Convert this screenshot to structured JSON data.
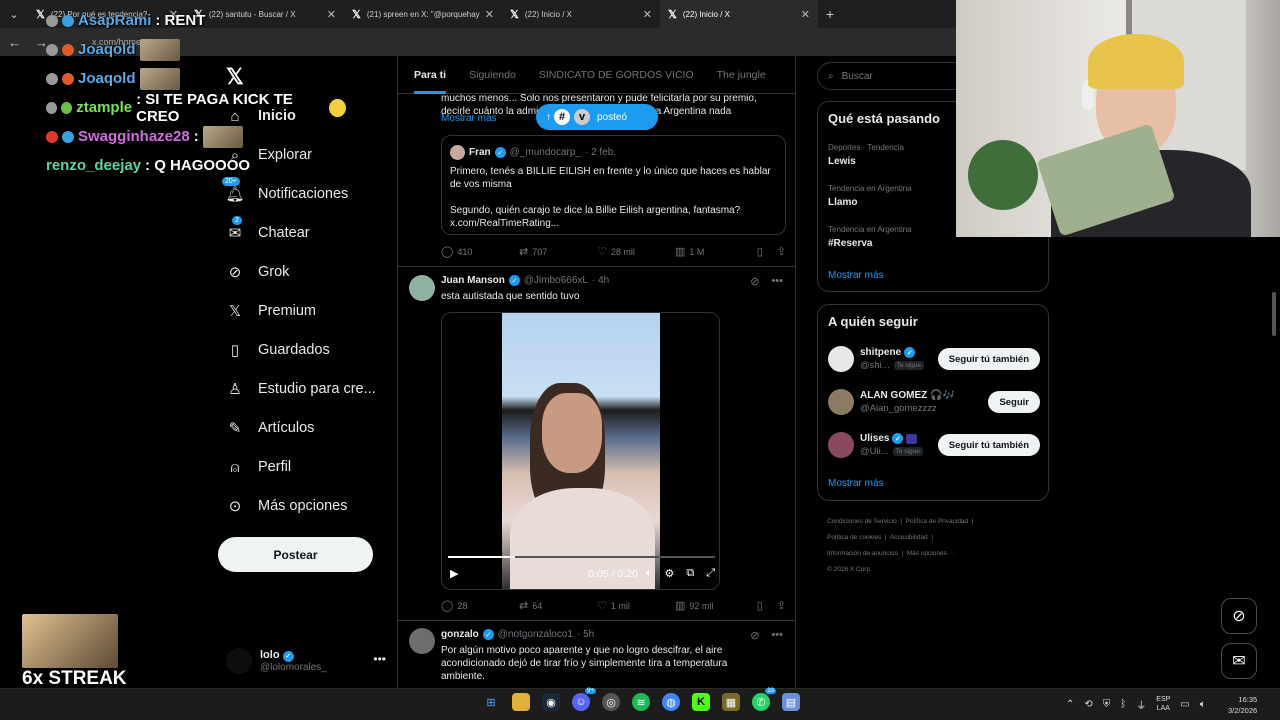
{
  "browser": {
    "tabs": [
      {
        "title": "(22) Por qué es tendencia?",
        "active": false
      },
      {
        "title": "(22) santutu - Buscar / X",
        "active": false
      },
      {
        "title": "(21) spreen en X: \"@porquehay",
        "active": false
      },
      {
        "title": "(22) Inicio / X",
        "active": false
      },
      {
        "title": "(22) Inicio / X",
        "active": true
      }
    ],
    "url": "x.com/home",
    "new_tab": "+"
  },
  "stream_chat": [
    {
      "user": "AsapRami",
      "message": ": RENT"
    },
    {
      "user": "Joaqold",
      "message": ""
    },
    {
      "user": "Joaqold",
      "message": ""
    },
    {
      "user": "ztample",
      "message": ": SI TE PAGA KICK TE CREO"
    },
    {
      "user": "Swagginhaze28",
      "message": ":"
    },
    {
      "user": "renzo_deejay",
      "message": ": Q HAGOOOO"
    }
  ],
  "nav": {
    "items": [
      {
        "label": "Inicio",
        "icon": "home-icon"
      },
      {
        "label": "Explorar",
        "icon": "search-icon"
      },
      {
        "label": "Notificaciones",
        "icon": "bell-icon",
        "count": "20+"
      },
      {
        "label": "Chatear",
        "icon": "mail-icon",
        "count": "2"
      },
      {
        "label": "Grok",
        "icon": "grok-icon"
      },
      {
        "label": "Premium",
        "icon": "x-icon"
      },
      {
        "label": "Guardados",
        "icon": "bookmark-icon"
      },
      {
        "label": "Estudio para cre...",
        "icon": "studio-icon"
      },
      {
        "label": "Artículos",
        "icon": "article-icon"
      },
      {
        "label": "Perfil",
        "icon": "person-icon"
      },
      {
        "label": "Más opciones",
        "icon": "more-icon"
      }
    ],
    "post_button": "Postear",
    "account": {
      "name": "lolo",
      "handle": "@lolomorales_"
    }
  },
  "feed": {
    "tabs": [
      "Para ti",
      "Siguiendo",
      "SINDICATO DE GORDOS VICIO",
      "The jungle"
    ],
    "posted_pill": "posteó",
    "post1": {
      "text_line1": "muchos menos... Solo nos presentaron y pude felicitarla por su premio,",
      "text_line2": "decirle cuánto la admiro y ojalá algún día venga a Argentina nada",
      "show_more": "Mostrar más",
      "quote": {
        "name": "Fran",
        "handle": "@_mundocarp_",
        "time": "· 2 feb.",
        "line1": "Primero, tenés a BILLIE EILISH en frente y lo único que haces es hablar",
        "line2": "de vos misma",
        "line3": "Segundo, quién carajo te dice la Billie Eilish argentina, fantasma?",
        "line4": "x.com/RealTimeRating..."
      },
      "replies": "410",
      "reposts": "707",
      "likes": "28 mil",
      "views": "1 M"
    },
    "post2": {
      "name": "Juan Manson",
      "handle": "@Jimbo666xL",
      "time": "· 4h",
      "text": "esta autistada que sentido tuvo",
      "video_time": "0:05 / 0:20",
      "video_progress": 0.25,
      "replies": "28",
      "reposts": "64",
      "likes": "1 mil",
      "views": "92 mil"
    },
    "post3": {
      "name": "gonzalo",
      "handle": "@notgonzaloco1",
      "time": "· 5h",
      "line1": "Por algún motivo poco aparente y que no logro descifrar, el aire",
      "line2": "acondicionado dejó de tirar frío y simplemente tira a temperatura",
      "line3": "ambiente."
    }
  },
  "sidebar": {
    "search_placeholder": "Buscar",
    "trends_title": "Qué está pasando",
    "trends": [
      {
        "category": "Deportes · Tendencia",
        "name": "Lewis"
      },
      {
        "category": "Tendencia en Argentina",
        "name": "Llamo"
      },
      {
        "category": "Tendencia en Argentina",
        "name": "#Reserva"
      }
    ],
    "trends_more": "Mostrar más",
    "follow_title": "A quién seguir",
    "follow": [
      {
        "name": "shitpene",
        "handle": "@shi...",
        "te_sigue": "Te sigue",
        "button": "Seguir tú también"
      },
      {
        "name": "ALAN GOMEZ 🎧🎶",
        "handle": "@Alan_gomezzzz",
        "te_sigue": "",
        "button": "Seguir"
      },
      {
        "name": "Ulises",
        "handle": "@Uli...",
        "te_sigue": "Te sigue",
        "button": "Seguir tú también"
      }
    ],
    "follow_more": "Mostrar más",
    "footer": {
      "line1a": "Condiciones de Servicio",
      "line1b": "Política de Privacidad",
      "line2a": "Política de cookies",
      "line2b": "Accesibilidad",
      "line3a": "Información de anuncios",
      "line3b": "Más opciones ···",
      "copyright": "© 2026 X Corp."
    }
  },
  "overlay": {
    "streak": "6x STREAK"
  },
  "taskbar": {
    "lang_top": "ESP",
    "lang_bottom": "LAA",
    "time": "16:35",
    "date": "3/2/2026",
    "badge_discord": "9+",
    "badge_whatsapp": "33"
  }
}
